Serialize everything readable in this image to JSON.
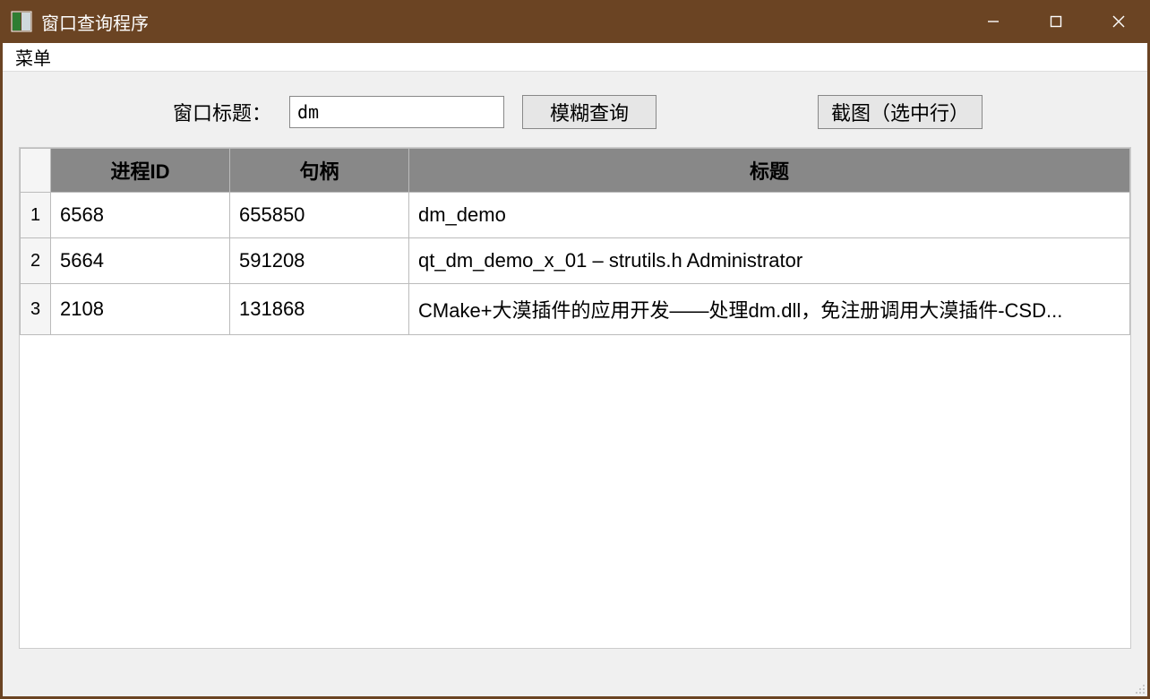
{
  "window": {
    "title": "窗口查询程序",
    "menu_label": "菜单"
  },
  "toolbar": {
    "field_label": "窗口标题：",
    "input_value": "dm",
    "search_label": "模糊查询",
    "screenshot_label": "截图（选中行）"
  },
  "table": {
    "headers": {
      "pid": "进程ID",
      "handle": "句柄",
      "title": "标题"
    },
    "rows": [
      {
        "n": "1",
        "pid": "6568",
        "handle": "655850",
        "title": "dm_demo"
      },
      {
        "n": "2",
        "pid": "5664",
        "handle": "591208",
        "title": "qt_dm_demo_x_01 – strutils.h Administrator"
      },
      {
        "n": "3",
        "pid": "2108",
        "handle": "131868",
        "title": "CMake+大漠插件的应用开发——处理dm.dll，免注册调用大漠插件-CSD..."
      }
    ]
  }
}
